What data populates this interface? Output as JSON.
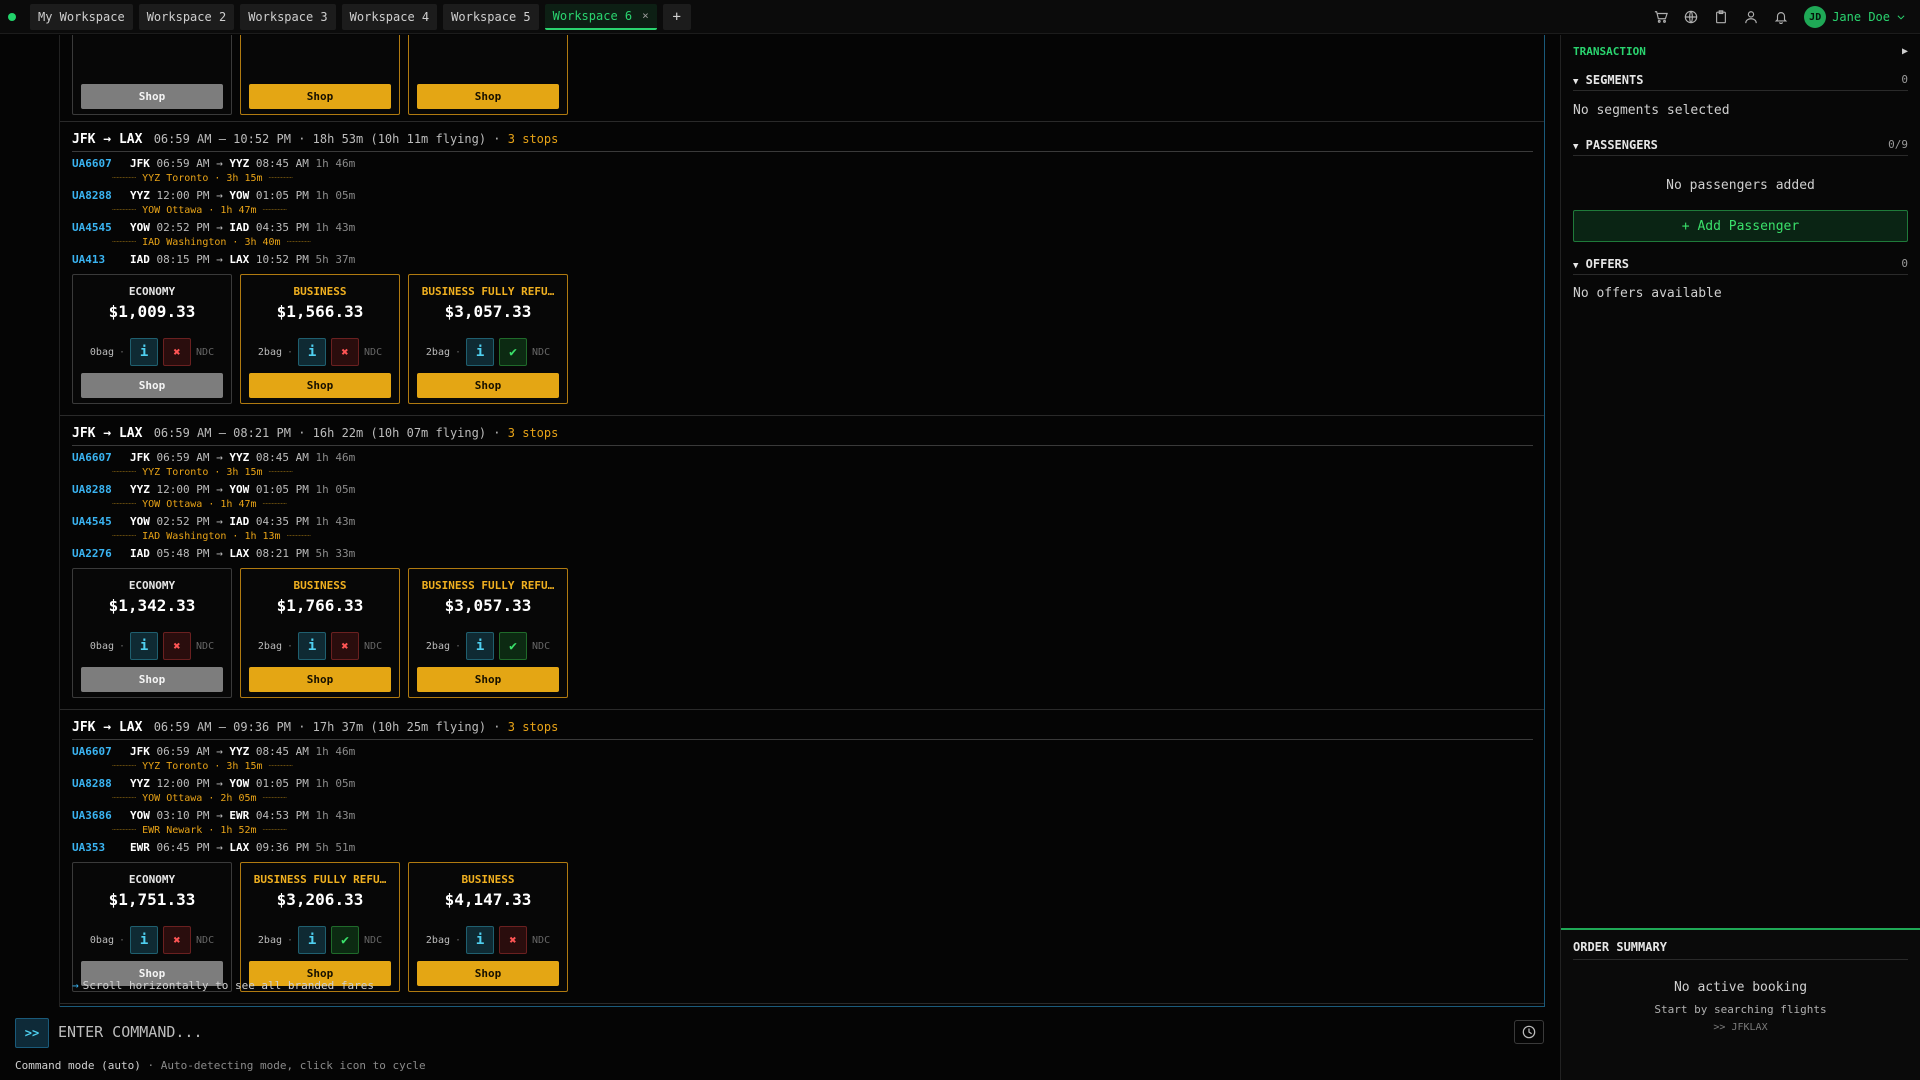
{
  "tabs": [
    {
      "label": "My Workspace",
      "active": false
    },
    {
      "label": "Workspace 2",
      "active": false
    },
    {
      "label": "Workspace 3",
      "active": false
    },
    {
      "label": "Workspace 4",
      "active": false
    },
    {
      "label": "Workspace 5",
      "active": false
    },
    {
      "label": "Workspace 6",
      "active": true
    }
  ],
  "tab_close": "×",
  "tab_add": "+",
  "user": {
    "initials": "JD",
    "name": "Jane Doe"
  },
  "icons": [
    "cart-icon",
    "globe-icon",
    "clipboard-icon",
    "user-icon",
    "bell-icon"
  ],
  "colors": {
    "accent": "#2ad46f",
    "flight": "#3ab4f2",
    "warn": "#e8a317",
    "shop": "#e4a614"
  },
  "labels": {
    "shop": "Shop",
    "ndc": "NDC",
    "info": "i",
    "no": "✖",
    "yes": "✔",
    "sep": "·"
  },
  "top_partial": {
    "shops": [
      "Shop",
      "Shop",
      "Shop"
    ]
  },
  "results": [
    {
      "route": "JFK → LAX",
      "time": "06:59 AM – 10:52 PM",
      "duration": "18h 53m (10h 11m flying)",
      "stops": "3 stops",
      "segments": [
        {
          "flight": "UA6607",
          "from": "JFK",
          "dep": "06:59 AM",
          "to": "YYZ",
          "arr": "08:45 AM",
          "dur": "1h 46m",
          "layover": "YYZ Toronto · 3h 15m"
        },
        {
          "flight": "UA8288",
          "from": "YYZ",
          "dep": "12:00 PM",
          "to": "YOW",
          "arr": "01:05 PM",
          "dur": "1h 05m",
          "layover": "YOW Ottawa · 1h 47m"
        },
        {
          "flight": "UA4545",
          "from": "YOW",
          "dep": "02:52 PM",
          "to": "IAD",
          "arr": "04:35 PM",
          "dur": "1h 43m",
          "layover": "IAD Washington · 3h 40m"
        },
        {
          "flight": "UA413",
          "from": "IAD",
          "dep": "08:15 PM",
          "to": "LAX",
          "arr": "10:52 PM",
          "dur": "5h 37m",
          "layover": ""
        }
      ],
      "fares": [
        {
          "name": "ECONOMY",
          "price": "$1,009.33",
          "bag": "0bag",
          "refund": false,
          "grey": true
        },
        {
          "name": "BUSINESS",
          "price": "$1,566.33",
          "bag": "2bag",
          "refund": false,
          "grey": false
        },
        {
          "name": "BUSINESS FULLY REFU…",
          "price": "$3,057.33",
          "bag": "2bag",
          "refund": true,
          "grey": false
        }
      ]
    },
    {
      "route": "JFK → LAX",
      "time": "06:59 AM – 08:21 PM",
      "duration": "16h 22m (10h 07m flying)",
      "stops": "3 stops",
      "segments": [
        {
          "flight": "UA6607",
          "from": "JFK",
          "dep": "06:59 AM",
          "to": "YYZ",
          "arr": "08:45 AM",
          "dur": "1h 46m",
          "layover": "YYZ Toronto · 3h 15m"
        },
        {
          "flight": "UA8288",
          "from": "YYZ",
          "dep": "12:00 PM",
          "to": "YOW",
          "arr": "01:05 PM",
          "dur": "1h 05m",
          "layover": "YOW Ottawa · 1h 47m"
        },
        {
          "flight": "UA4545",
          "from": "YOW",
          "dep": "02:52 PM",
          "to": "IAD",
          "arr": "04:35 PM",
          "dur": "1h 43m",
          "layover": "IAD Washington · 1h 13m"
        },
        {
          "flight": "UA2276",
          "from": "IAD",
          "dep": "05:48 PM",
          "to": "LAX",
          "arr": "08:21 PM",
          "dur": "5h 33m",
          "layover": ""
        }
      ],
      "fares": [
        {
          "name": "ECONOMY",
          "price": "$1,342.33",
          "bag": "0bag",
          "refund": false,
          "grey": true
        },
        {
          "name": "BUSINESS",
          "price": "$1,766.33",
          "bag": "2bag",
          "refund": false,
          "grey": false
        },
        {
          "name": "BUSINESS FULLY REFU…",
          "price": "$3,057.33",
          "bag": "2bag",
          "refund": true,
          "grey": false
        }
      ]
    },
    {
      "route": "JFK → LAX",
      "time": "06:59 AM – 09:36 PM",
      "duration": "17h 37m (10h 25m flying)",
      "stops": "3 stops",
      "segments": [
        {
          "flight": "UA6607",
          "from": "JFK",
          "dep": "06:59 AM",
          "to": "YYZ",
          "arr": "08:45 AM",
          "dur": "1h 46m",
          "layover": "YYZ Toronto · 3h 15m"
        },
        {
          "flight": "UA8288",
          "from": "YYZ",
          "dep": "12:00 PM",
          "to": "YOW",
          "arr": "01:05 PM",
          "dur": "1h 05m",
          "layover": "YOW Ottawa · 2h 05m"
        },
        {
          "flight": "UA3686",
          "from": "YOW",
          "dep": "03:10 PM",
          "to": "EWR",
          "arr": "04:53 PM",
          "dur": "1h 43m",
          "layover": "EWR Newark · 1h 52m"
        },
        {
          "flight": "UA353",
          "from": "EWR",
          "dep": "06:45 PM",
          "to": "LAX",
          "arr": "09:36 PM",
          "dur": "5h 51m",
          "layover": ""
        }
      ],
      "fares": [
        {
          "name": "ECONOMY",
          "price": "$1,751.33",
          "bag": "0bag",
          "refund": false,
          "grey": true
        },
        {
          "name": "BUSINESS FULLY REFU…",
          "price": "$3,206.33",
          "bag": "2bag",
          "refund": true,
          "grey": false
        },
        {
          "name": "BUSINESS",
          "price": "$4,147.33",
          "bag": "2bag",
          "refund": false,
          "grey": false
        }
      ]
    }
  ],
  "hint": "Scroll horizontally to see all branded fares",
  "hint_arrow": "→",
  "command": {
    "button": ">>",
    "placeholder": "ENTER COMMAND...",
    "mode": "Command mode (auto)",
    "mode_desc": "· Auto-detecting mode, click icon to cycle"
  },
  "panel": {
    "title": "TRANSACTION",
    "toggle": "▶",
    "segments_title": "SEGMENTS",
    "segments_count": "0",
    "segments_empty": "No segments selected",
    "passengers_title": "PASSENGERS",
    "passengers_count": "0/9",
    "passengers_empty": "No passengers added",
    "add_passenger": "+ Add Passenger",
    "offers_title": "OFFERS",
    "offers_count": "0",
    "offers_empty": "No offers available",
    "caret": "▼"
  },
  "order": {
    "title": "ORDER SUMMARY",
    "empty": "No active booking",
    "sub": "Start by searching flights",
    "example": ">> JFKLAX"
  }
}
